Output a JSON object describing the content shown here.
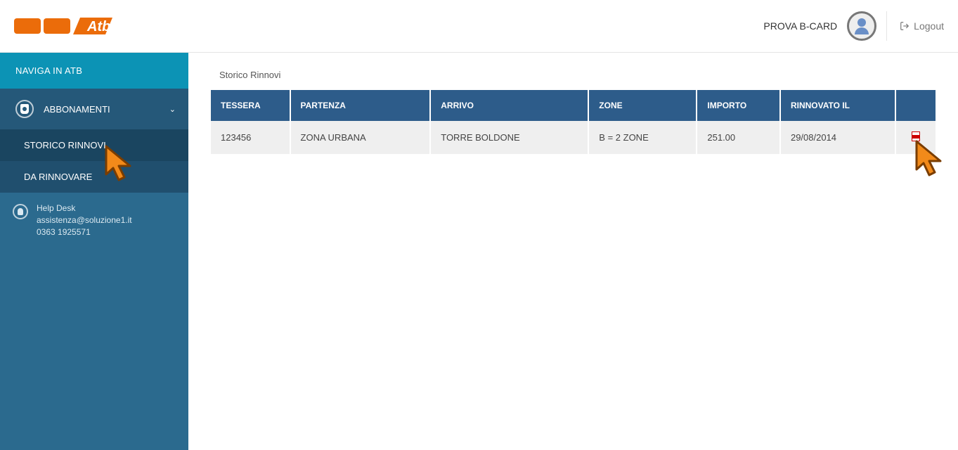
{
  "header": {
    "username": "PROVA B-CARD",
    "logout_label": "Logout"
  },
  "sidebar": {
    "nav_title": "NAVIGA IN ATB",
    "abbonamenti_label": "ABBONAMENTI",
    "storico_label": "STORICO RINNOVI",
    "da_rinnovare_label": "DA RINNOVARE",
    "helpdesk": {
      "title": "Help Desk",
      "email": "assistenza@soluzione1.it",
      "phone": "0363 1925571"
    }
  },
  "main": {
    "page_title": "Storico Rinnovi",
    "columns": {
      "tessera": "TESSERA",
      "partenza": "PARTENZA",
      "arrivo": "ARRIVO",
      "zone": "ZONE",
      "importo": "IMPORTO",
      "rinnovato": "RINNOVATO IL"
    },
    "rows": [
      {
        "tessera": "123456",
        "partenza": "ZONA URBANA",
        "arrivo": "TORRE BOLDONE",
        "zone": "B = 2 ZONE",
        "importo": "251.00",
        "rinnovato": "29/08/2014"
      }
    ]
  }
}
